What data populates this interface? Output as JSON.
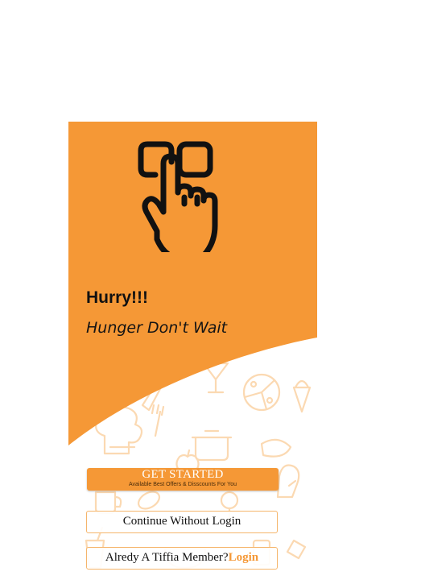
{
  "splash": {
    "headline": "Hurry!!!",
    "tagline": "Hunger Don't Wait"
  },
  "actions": {
    "get_started": {
      "label": "GET STARTED",
      "sublabel": "Available Best Offers & Disscounts For You"
    },
    "continue_without_login": "Continue Without Login",
    "member_prompt": "Alredy A Tiffia Member?",
    "login_link": "Login"
  },
  "icons": {
    "hero": "hand-pointer-icon",
    "background_pattern": "food-doodle-pattern"
  },
  "colors": {
    "brand_orange": "#f59836",
    "doodle": "#fbd9b2",
    "text_dark": "#111111"
  }
}
